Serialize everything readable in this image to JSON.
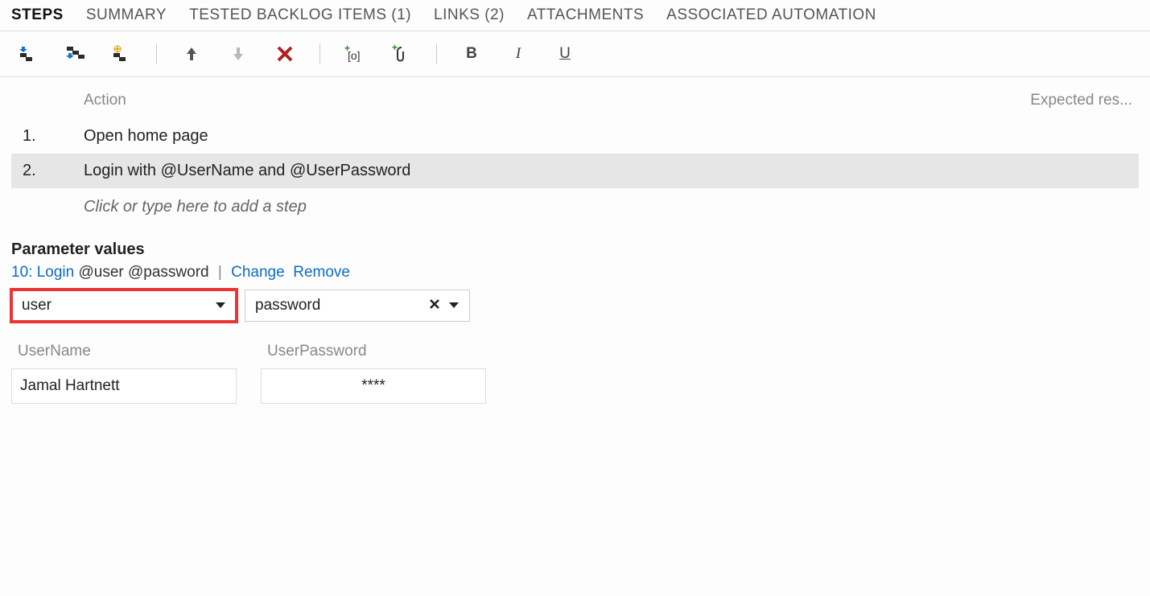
{
  "tabs": {
    "steps": "STEPS",
    "summary": "SUMMARY",
    "backlog": "TESTED BACKLOG ITEMS (1)",
    "links": "LINKS (2)",
    "attachments": "ATTACHMENTS",
    "automation": "ASSOCIATED AUTOMATION"
  },
  "toolbar": {
    "bold": "B",
    "italic": "I",
    "underline": "U"
  },
  "steps": {
    "header_action": "Action",
    "header_expected": "Expected res...",
    "rows": [
      {
        "num": "1.",
        "action": "Open home page"
      },
      {
        "num": "2.",
        "action": "Login with  @UserName and  @UserPassword"
      }
    ],
    "placeholder": "Click or type here to add a step"
  },
  "params": {
    "title": "Parameter values",
    "link_id_text": "10: Login",
    "link_text_suffix": " @user @password",
    "change": "Change",
    "remove": "Remove",
    "dropdowns": {
      "user": "user",
      "password": "password"
    },
    "columns": {
      "username_header": "UserName",
      "password_header": "UserPassword",
      "username_value": "Jamal Hartnett",
      "password_value": "****"
    }
  }
}
